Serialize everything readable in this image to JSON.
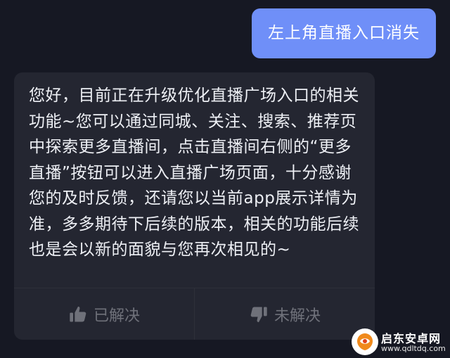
{
  "chat": {
    "user_message": "左上角直播入口消失",
    "reply_text": "您好，目前正在升级优化直播广场入口的相关功能~您可以通过同城、关注、搜索、推荐页中探索更多直播间，点击直播间右侧的“更多直播”按钮可以进入直播广场页面，十分感谢您的及时反馈，还请您以当前app展示详情为准，多多期待下后续的版本，相关的功能后续也是会以新的面貌与您再次相见的~",
    "resolved_label": "已解决",
    "unresolved_label": "未解决"
  },
  "watermark": {
    "title": "启东安卓网",
    "url": "www.qdltdq.com"
  },
  "colors": {
    "background": "#161823",
    "user_bubble": "#6f8ff8",
    "reply_card": "#242631",
    "muted_text": "#6f717a"
  }
}
